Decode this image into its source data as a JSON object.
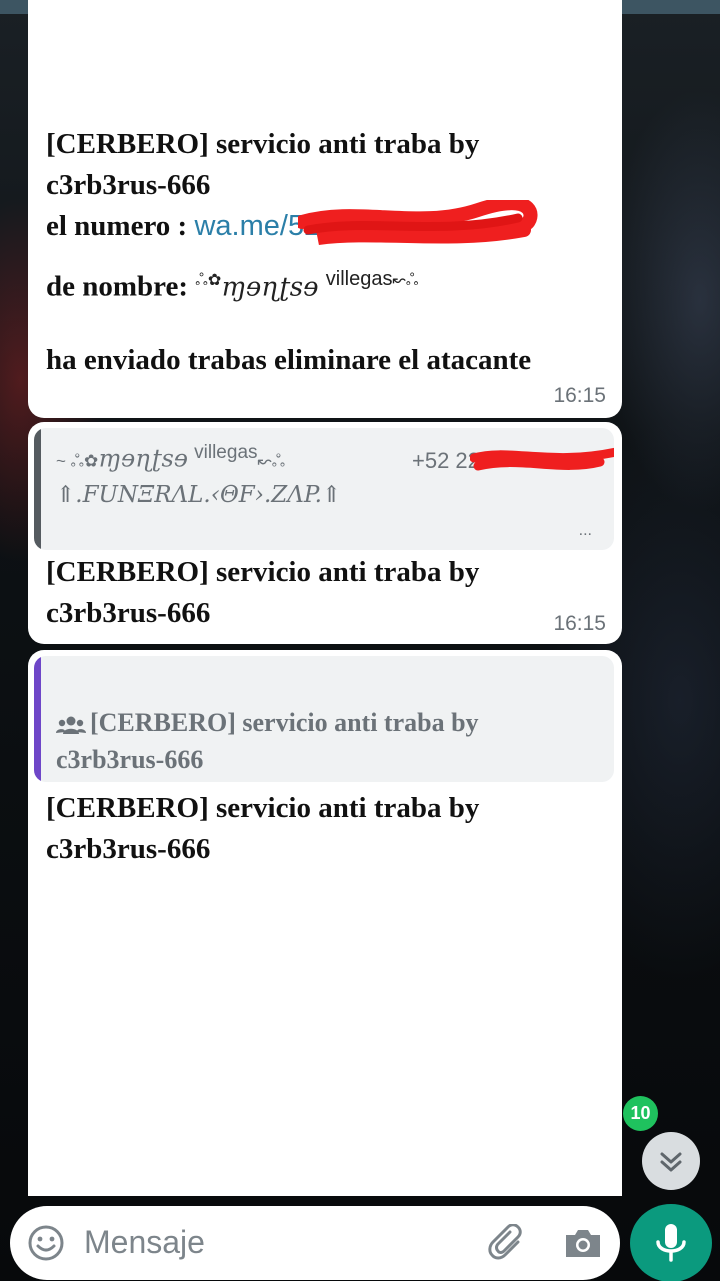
{
  "colors": {
    "topbar": "#3d5562",
    "bubble": "#ffffff",
    "link": "#2b7fa8",
    "timestamp": "#6b7278",
    "quote_bar_1": "#555b60",
    "quote_bar_2": "#6e46c8",
    "mic_button": "#0b9a7e",
    "unread_badge": "#1fc25e",
    "redaction": "#ef1f1f"
  },
  "messages": [
    {
      "line1": "[CERBERO] servicio anti traba by",
      "line2": "c3rb3rus-666",
      "numero_label": "el numero :",
      "numero_link": "wa.me/52",
      "nombre_label": "de nombre:",
      "nombre_prefix": "ஃ✿",
      "nombre_fancy": "ɱɘɳʈsɘ",
      "nombre_small": "villegas",
      "nombre_suffix": "↜ஃ",
      "body": "ha enviado trabas eliminare el atacante",
      "time": "16:15"
    },
    {
      "quote_author_prefix": "~ ஃ✿",
      "quote_author_fancy": "ɱɘɳʈsɘ",
      "quote_author_small": "villegas",
      "quote_author_suffix": "↜ஃ",
      "quote_phone": "+52 22",
      "quote_text": "⇑.FUNΞRΛL.‹ΘF›.ZΛP.⇑",
      "quote_more": "...",
      "line1": "[CERBERO] servicio anti traba by",
      "line2": "c3rb3rus-666",
      "time": "16:15"
    },
    {
      "quote_icon": "group-icon",
      "quote_line1": "[CERBERO] servicio anti traba by",
      "quote_line2": "c3rb3rus-666",
      "line1": "[CERBERO] servicio anti traba by",
      "line2": "c3rb3rus-666"
    }
  ],
  "composer": {
    "placeholder": "Mensaje",
    "emoji_icon": "emoji-icon",
    "attach_icon": "paperclip-icon",
    "camera_icon": "camera-icon",
    "mic_icon": "microphone-icon"
  },
  "scroll": {
    "unread_count": "10",
    "icon": "double-chevron-down-icon"
  }
}
